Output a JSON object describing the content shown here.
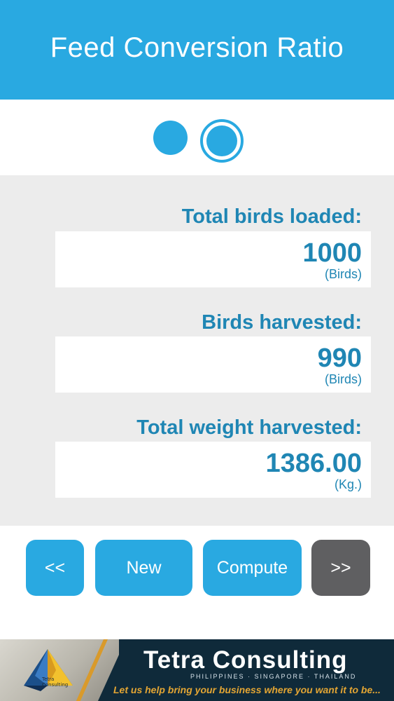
{
  "header": {
    "title": "Feed Conversion Ratio"
  },
  "pager": {
    "page_count": 2,
    "current_page": 2
  },
  "fields": {
    "total_birds_loaded": {
      "label": "Total birds loaded:",
      "value": "1000",
      "unit": "(Birds)"
    },
    "birds_harvested": {
      "label": "Birds harvested:",
      "value": "990",
      "unit": "(Birds)"
    },
    "total_weight_harvested": {
      "label": "Total weight harvested:",
      "value": "1386.00",
      "unit": "(Kg.)"
    }
  },
  "buttons": {
    "back": "<<",
    "new": "New",
    "compute": "Compute",
    "next": ">>"
  },
  "banner": {
    "company": "Tetra Consulting",
    "locations": "PHILIPPINES · SINGAPORE · THAILAND",
    "tagline": "Let us  help bring your business where you want it to be...",
    "logo_text": "Tetra Consulting"
  },
  "colors": {
    "primary": "#29a9e1",
    "text_blue": "#1f86b4",
    "panel_gray": "#ececec",
    "disabled_button": "#5f5f61",
    "banner_dark": "#0f2a3a",
    "banner_gold": "#e3a533"
  }
}
